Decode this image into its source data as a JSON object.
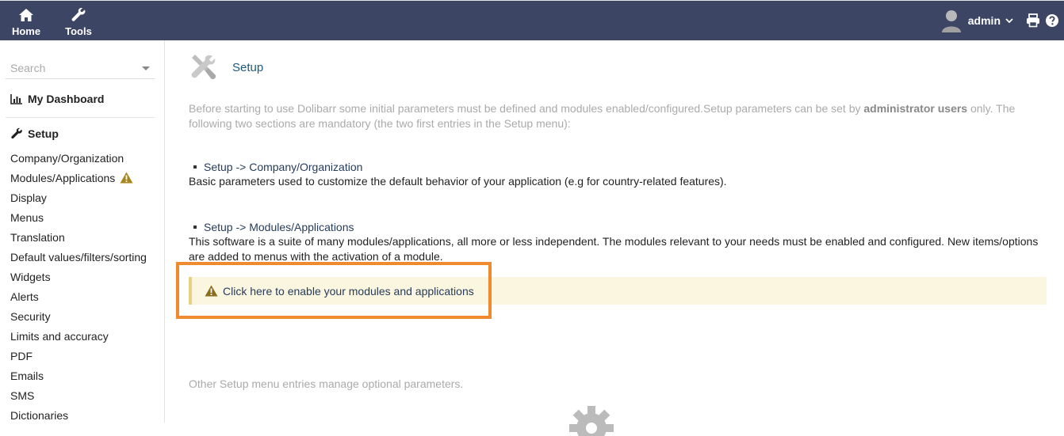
{
  "topbar": {
    "nav": [
      {
        "label": "Home",
        "icon": "home-icon"
      },
      {
        "label": "Tools",
        "icon": "wrench-icon"
      }
    ],
    "user": {
      "name": "admin"
    },
    "icons": [
      "print-icon",
      "help-icon"
    ],
    "colors": {
      "background": "#3c4664",
      "text": "#ffffff"
    }
  },
  "sidebar": {
    "search_placeholder": "Search",
    "dashboard": "My Dashboard",
    "setup": "Setup",
    "items": [
      {
        "label": "Company/Organization"
      },
      {
        "label": "Modules/Applications",
        "warning": true
      },
      {
        "label": "Display"
      },
      {
        "label": "Menus"
      },
      {
        "label": "Translation"
      },
      {
        "label": "Default values/filters/sorting"
      },
      {
        "label": "Widgets"
      },
      {
        "label": "Alerts"
      },
      {
        "label": "Security"
      },
      {
        "label": "Limits and accuracy"
      },
      {
        "label": "PDF"
      },
      {
        "label": "Emails"
      },
      {
        "label": "SMS"
      },
      {
        "label": "Dictionaries"
      }
    ]
  },
  "main": {
    "title": "Setup",
    "intro_before": "Before starting to use Dolibarr some initial parameters must be defined and modules enabled/configured.Setup parameters can be set by ",
    "intro_bold": "administrator users",
    "intro_after": " only. The following two sections are mandatory (the two first entries in the Setup menu):",
    "step1_link": "Setup -> Company/Organization",
    "step1_desc": "Basic parameters used to customize the default behavior of your application (e.g for country-related features).",
    "step2_link": "Setup -> Modules/Applications",
    "step2_desc": "This software is a suite of many modules/applications, all more or less independent. The modules relevant to your needs must be enabled and configured. New items/options are added to menus with the activation of a module.",
    "notice": "Click here to enable your modules and applications",
    "other": "Other Setup menu entries manage optional parameters.",
    "colors": {
      "notice_bg": "#fbf6df",
      "notice_border": "#e8cf86",
      "highlight": "#f08a2e",
      "link": "#263c5c"
    }
  }
}
